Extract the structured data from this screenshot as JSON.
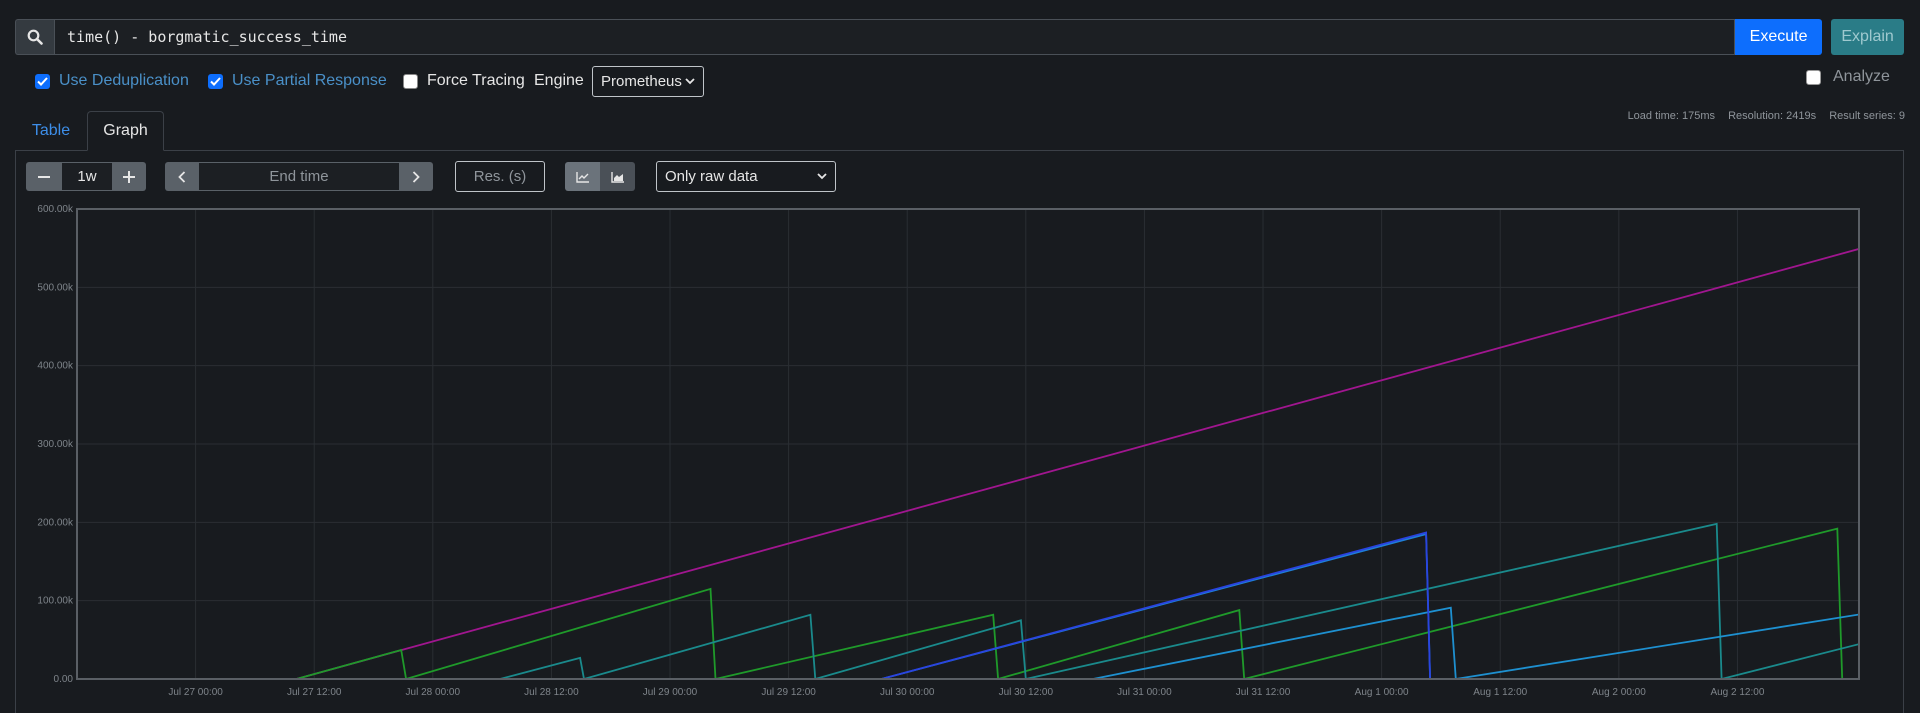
{
  "query": {
    "expression": "time() - borgmatic_success_time",
    "execute_label": "Execute",
    "explain_label": "Explain"
  },
  "options": {
    "dedup_label": "Use Deduplication",
    "dedup_checked": true,
    "partial_label": "Use Partial Response",
    "partial_checked": true,
    "tracing_label": "Force Tracing",
    "tracing_checked": false,
    "engine_label": "Engine",
    "engine_value": "Prometheus",
    "analyze_label": "Analyze",
    "analyze_checked": false
  },
  "stats": {
    "load_time": "Load time: 175ms",
    "resolution": "Resolution: 2419s",
    "result_series": "Result series: 9"
  },
  "tabs": [
    {
      "label": "Table",
      "active": false
    },
    {
      "label": "Graph",
      "active": true
    }
  ],
  "graph_controls": {
    "range_value": "1w",
    "end_time_placeholder": "End time",
    "resolution_placeholder": "Res. (s)",
    "data_mode": "Only raw data"
  },
  "icons": {
    "search": "search-icon",
    "minus": "minus-icon",
    "plus": "plus-icon",
    "prev": "chevron-left-icon",
    "next": "chevron-right-icon",
    "line_mode": "line-chart-icon",
    "stacked_mode": "stacked-chart-icon",
    "select_caret": "chevron-down-icon"
  },
  "colors": {
    "execute": "#0d6efd",
    "explain": "#2a7c87",
    "checkbox": "#0d6efd",
    "tab_active_text": "#3d8ee8"
  },
  "chart_data": {
    "type": "line",
    "ylim": [
      0,
      600000
    ],
    "y_ticks": [
      {
        "value": 0,
        "label": "0.00"
      },
      {
        "value": 100000,
        "label": "100.00k"
      },
      {
        "value": 200000,
        "label": "200.00k"
      },
      {
        "value": 300000,
        "label": "300.00k"
      },
      {
        "value": 400000,
        "label": "400.00k"
      },
      {
        "value": 500000,
        "label": "500.00k"
      },
      {
        "value": 600000,
        "label": "600.00k"
      }
    ],
    "x_range_hours": [
      -12,
      168.3
    ],
    "x_ticks": [
      {
        "hour": 0,
        "label": "Jul 27 00:00"
      },
      {
        "hour": 12,
        "label": "Jul 27 12:00"
      },
      {
        "hour": 24,
        "label": "Jul 28 00:00"
      },
      {
        "hour": 36,
        "label": "Jul 28 12:00"
      },
      {
        "hour": 48,
        "label": "Jul 29 00:00"
      },
      {
        "hour": 60,
        "label": "Jul 29 12:00"
      },
      {
        "hour": 72,
        "label": "Jul 30 00:00"
      },
      {
        "hour": 84,
        "label": "Jul 30 12:00"
      },
      {
        "hour": 96,
        "label": "Jul 31 00:00"
      },
      {
        "hour": 108,
        "label": "Jul 31 12:00"
      },
      {
        "hour": 120,
        "label": "Aug 1 00:00"
      },
      {
        "hour": 132,
        "label": "Aug 1 12:00"
      },
      {
        "hour": 144,
        "label": "Aug 2 00:00"
      },
      {
        "hour": 156,
        "label": "Aug 2 12:00"
      }
    ],
    "grid": true,
    "series": [
      {
        "color": "#a0168f",
        "points": [
          [
            10.2,
            0
          ],
          [
            168.3,
            549000
          ]
        ]
      },
      {
        "color": "#1f9a2a",
        "points": [
          [
            10.2,
            0
          ],
          [
            20.8,
            37000
          ],
          [
            21.3,
            0
          ],
          [
            52.1,
            115000
          ],
          [
            52.6,
            0
          ],
          [
            80.7,
            82000
          ],
          [
            81.2,
            0
          ],
          [
            105.6,
            88000
          ],
          [
            106.1,
            0
          ],
          [
            166.1,
            192000
          ],
          [
            166.6,
            0
          ]
        ]
      },
      {
        "color": "#1a8a8c",
        "points": [
          [
            30.8,
            0
          ],
          [
            38.9,
            27000
          ],
          [
            39.3,
            0
          ],
          [
            62.2,
            82000
          ],
          [
            62.7,
            0
          ],
          [
            83.5,
            75000
          ],
          [
            84.0,
            0
          ],
          [
            153.9,
            198000
          ],
          [
            154.4,
            0
          ],
          [
            182.5,
            90000
          ]
        ]
      },
      {
        "color": "#1e7fd6",
        "points": [
          [
            69.4,
            0
          ],
          [
            124.5,
            185000
          ],
          [
            124.9,
            0
          ]
        ]
      },
      {
        "color": "#1e90d0",
        "points": [
          [
            90.8,
            0
          ],
          [
            127.0,
            91000
          ],
          [
            127.5,
            0
          ],
          [
            173.6,
            93000
          ]
        ]
      },
      {
        "color": "#2a44e0",
        "points": [
          [
            69.4,
            0
          ],
          [
            124.5,
            187000
          ],
          [
            124.9,
            0
          ]
        ]
      }
    ]
  }
}
